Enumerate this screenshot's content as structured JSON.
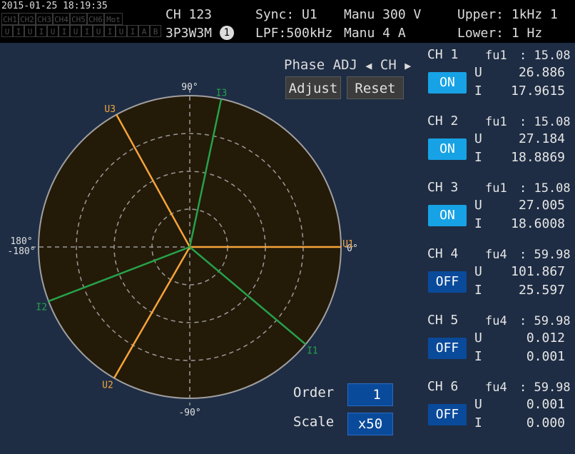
{
  "header": {
    "datetime": "2015-01-25 18:19:35",
    "status_row1": [
      "CH1",
      "CH2",
      "CH3",
      "CH4",
      "CH5",
      "CH6",
      "Mot"
    ],
    "status_row2": [
      "U",
      "I",
      "U",
      "I",
      "U",
      "I",
      "U",
      "I",
      "U",
      "I",
      "U",
      "I",
      "A",
      "B"
    ],
    "channels": "CH 123",
    "wiring": "3P3W3M",
    "wiring_badge": "1",
    "sync": "Sync: U1",
    "lpf": "LPF:500kHz",
    "range_u": "Manu 300 V",
    "range_i": "Manu   4 A",
    "upper": "Upper:  1kHz  1",
    "lower": "Lower:  1 Hz"
  },
  "controls": {
    "phase_adj": "Phase ADJ",
    "ch": "CH",
    "adjust": "Adjust",
    "reset": "Reset",
    "order_label": "Order",
    "order_value": "1",
    "scale_label": "Scale",
    "scale_value": "x50"
  },
  "vector": {
    "label_top": "90°",
    "label_bottom": "-90°",
    "label_left_1": "180°",
    "label_left_2": "-180°",
    "label_right": "0°",
    "vectors": [
      {
        "name": "U1",
        "angle": 0,
        "mag": 1.0,
        "color": "#f5a43a"
      },
      {
        "name": "I1",
        "angle": -40,
        "mag": 1.0,
        "color": "#25a24a"
      },
      {
        "name": "U2",
        "angle": -120,
        "mag": 1.0,
        "color": "#f5a43a"
      },
      {
        "name": "I2",
        "angle": -159,
        "mag": 1.0,
        "color": "#25a24a"
      },
      {
        "name": "U3",
        "angle": 119,
        "mag": 1.0,
        "color": "#f5a43a"
      },
      {
        "name": "I3",
        "angle": 78,
        "mag": 1.0,
        "color": "#25a24a"
      }
    ],
    "bg_color": "#241a08",
    "ring_color": "#a0a0a0"
  },
  "channels": [
    {
      "title": "CH 1",
      "fu": "fu1",
      "freq": ": 15.08",
      "state": "ON",
      "u": "26.886",
      "i": "17.9615"
    },
    {
      "title": "CH 2",
      "fu": "fu1",
      "freq": ": 15.08",
      "state": "ON",
      "u": "27.184",
      "i": "18.8869"
    },
    {
      "title": "CH 3",
      "fu": "fu1",
      "freq": ": 15.08",
      "state": "ON",
      "u": "27.005",
      "i": "18.6008"
    },
    {
      "title": "CH 4",
      "fu": "fu4",
      "freq": ": 59.98",
      "state": "OFF",
      "u": "101.867",
      "i": "25.597"
    },
    {
      "title": "CH 5",
      "fu": "fu4",
      "freq": ": 59.98",
      "state": "OFF",
      "u": "0.012",
      "i": "0.001"
    },
    {
      "title": "CH 6",
      "fu": "fu4",
      "freq": ": 59.98",
      "state": "OFF",
      "u": "0.001",
      "i": "0.000"
    }
  ],
  "labels": {
    "u": "U",
    "i": "I"
  }
}
